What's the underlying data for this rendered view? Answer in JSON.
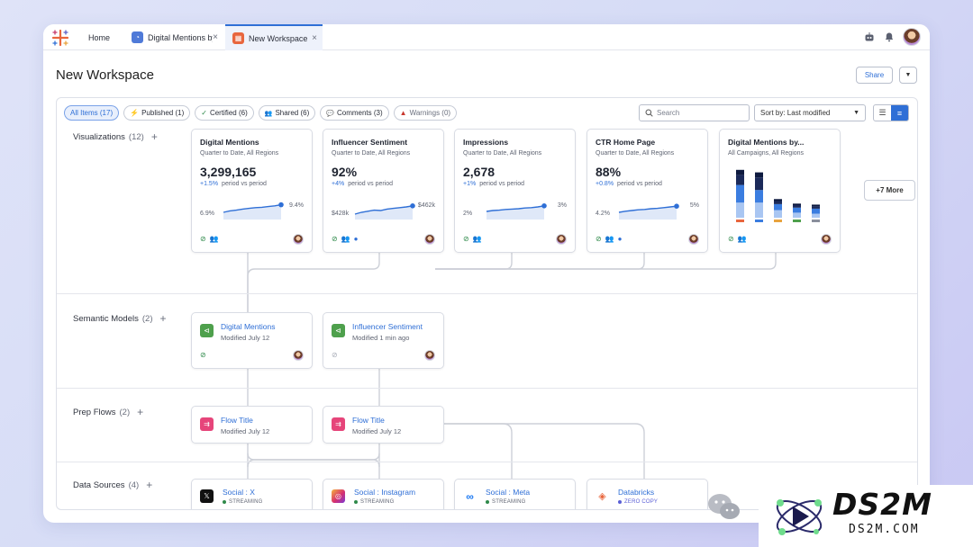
{
  "window": {
    "home_tab": "Home",
    "tabs": [
      {
        "label": "Digital Mentions by",
        "close": "×"
      },
      {
        "label": "New Workspace",
        "close": "×"
      }
    ]
  },
  "header": {
    "title": "New Workspace",
    "share_label": "Share",
    "more_icon": "▼"
  },
  "filters": [
    {
      "label": "All Items (17)",
      "icon": ""
    },
    {
      "label": "Published (1)",
      "icon": "⚡"
    },
    {
      "label": "Certified (6)",
      "icon": "✓"
    },
    {
      "label": "Shared (6)",
      "icon": "👥"
    },
    {
      "label": "Comments (3)",
      "icon": "💬"
    },
    {
      "label": "Warnings (0)",
      "icon": "▲"
    }
  ],
  "search": {
    "placeholder": "Search"
  },
  "sort": {
    "label": "Sort by: Last modified"
  },
  "sections": {
    "visualizations": {
      "label": "Visualizations",
      "count": "(12)",
      "plus": "+"
    },
    "semantic_models": {
      "label": "Semantic Models",
      "count": "(2)",
      "plus": "+"
    },
    "prep_flows": {
      "label": "Prep Flows",
      "count": "(2)",
      "plus": "+"
    },
    "data_sources": {
      "label": "Data Sources",
      "count": "(4)",
      "plus": "+"
    }
  },
  "visualizations": [
    {
      "title": "Digital Mentions",
      "subtitle": "Quarter to Date, All Regions",
      "value": "3,299,165",
      "delta": "+1.5%",
      "period": "period vs period",
      "min": "6.9%",
      "max": "9.4%",
      "trend": [
        0.3,
        0.38,
        0.42,
        0.48,
        0.52,
        0.56,
        0.58,
        0.62,
        0.66,
        0.72
      ],
      "icons": [
        "check",
        "users"
      ]
    },
    {
      "title": "Influencer Sentiment",
      "subtitle": "Quarter to Date, All Regions",
      "value": "92%",
      "delta": "+4%",
      "period": "period vs period",
      "min": "$428k",
      "max": "$462k",
      "trend": [
        0.2,
        0.3,
        0.36,
        0.42,
        0.4,
        0.48,
        0.52,
        0.56,
        0.6,
        0.66
      ],
      "icons": [
        "check",
        "users",
        "comment"
      ]
    },
    {
      "title": "Impressions",
      "subtitle": "Quarter to Date, All Regions",
      "value": "2,678",
      "delta": "+1%",
      "period": "period vs period",
      "min": "2%",
      "max": "3%",
      "trend": [
        0.35,
        0.4,
        0.42,
        0.46,
        0.48,
        0.5,
        0.54,
        0.56,
        0.6,
        0.66
      ],
      "icons": [
        "check",
        "users"
      ]
    },
    {
      "title": "CTR Home Page",
      "subtitle": "Quarter to Date, All Regions",
      "value": "88%",
      "delta": "+0.8%",
      "period": "period vs period",
      "min": "4.2%",
      "max": "5%",
      "trend": [
        0.3,
        0.36,
        0.4,
        0.44,
        0.46,
        0.5,
        0.52,
        0.56,
        0.6,
        0.64
      ],
      "icons": [
        "check",
        "users",
        "comment"
      ]
    },
    {
      "title": "Digital Mentions by...",
      "subtitle": "All Campaigns, All Regions",
      "icons": [
        "check",
        "users"
      ]
    }
  ],
  "more_label": "+7 More",
  "stacked_bars": [
    [
      0.3,
      0.35,
      0.2,
      0.1
    ],
    [
      0.3,
      0.25,
      0.25,
      0.1
    ],
    [
      0.15,
      0.12,
      0.06,
      0.04
    ],
    [
      0.1,
      0.1,
      0.05,
      0.03
    ],
    [
      0.08,
      0.1,
      0.05,
      0.03
    ]
  ],
  "semantic_models": [
    {
      "title": "Digital Mentions",
      "subtitle": "Modified July 12",
      "icon": "check"
    },
    {
      "title": "Influencer Sentiment",
      "subtitle": "Modified 1 min ago",
      "icon": "gray"
    }
  ],
  "prep_flows": [
    {
      "title": "Flow Title",
      "subtitle": "Modified July 12"
    },
    {
      "title": "Flow Title",
      "subtitle": "Modified July 12"
    }
  ],
  "data_sources": [
    {
      "title": "Social : X",
      "status": "STREAMING",
      "status_color": "#2f8a4a",
      "icon_bg": "#111111",
      "icon": "𝕏"
    },
    {
      "title": "Social : Instagram",
      "status": "STREAMING",
      "status_color": "#2f8a4a",
      "icon_bg": "#d6306f",
      "icon": "◎"
    },
    {
      "title": "Social : Meta",
      "status": "STREAMING",
      "status_color": "#2f8a4a",
      "icon_bg": "#ffffff",
      "icon": "∞"
    },
    {
      "title": "Databricks",
      "status": "ZERO COPY",
      "status_color": "#5a5fd6",
      "icon_bg": "#ffffff",
      "icon": "◈"
    }
  ],
  "colors": {
    "accent": "#2f6fd6",
    "check": "#2f8a4a",
    "semantic_icon": "#4ea04c",
    "flow_icon": "#e6457a",
    "bar_dark": "#1b2a5a",
    "bar_mid": "#3b7de0",
    "bar_light": "#a9c6f2"
  },
  "watermark": {
    "brand": "DS2M",
    "site": "DS2M.COM"
  }
}
